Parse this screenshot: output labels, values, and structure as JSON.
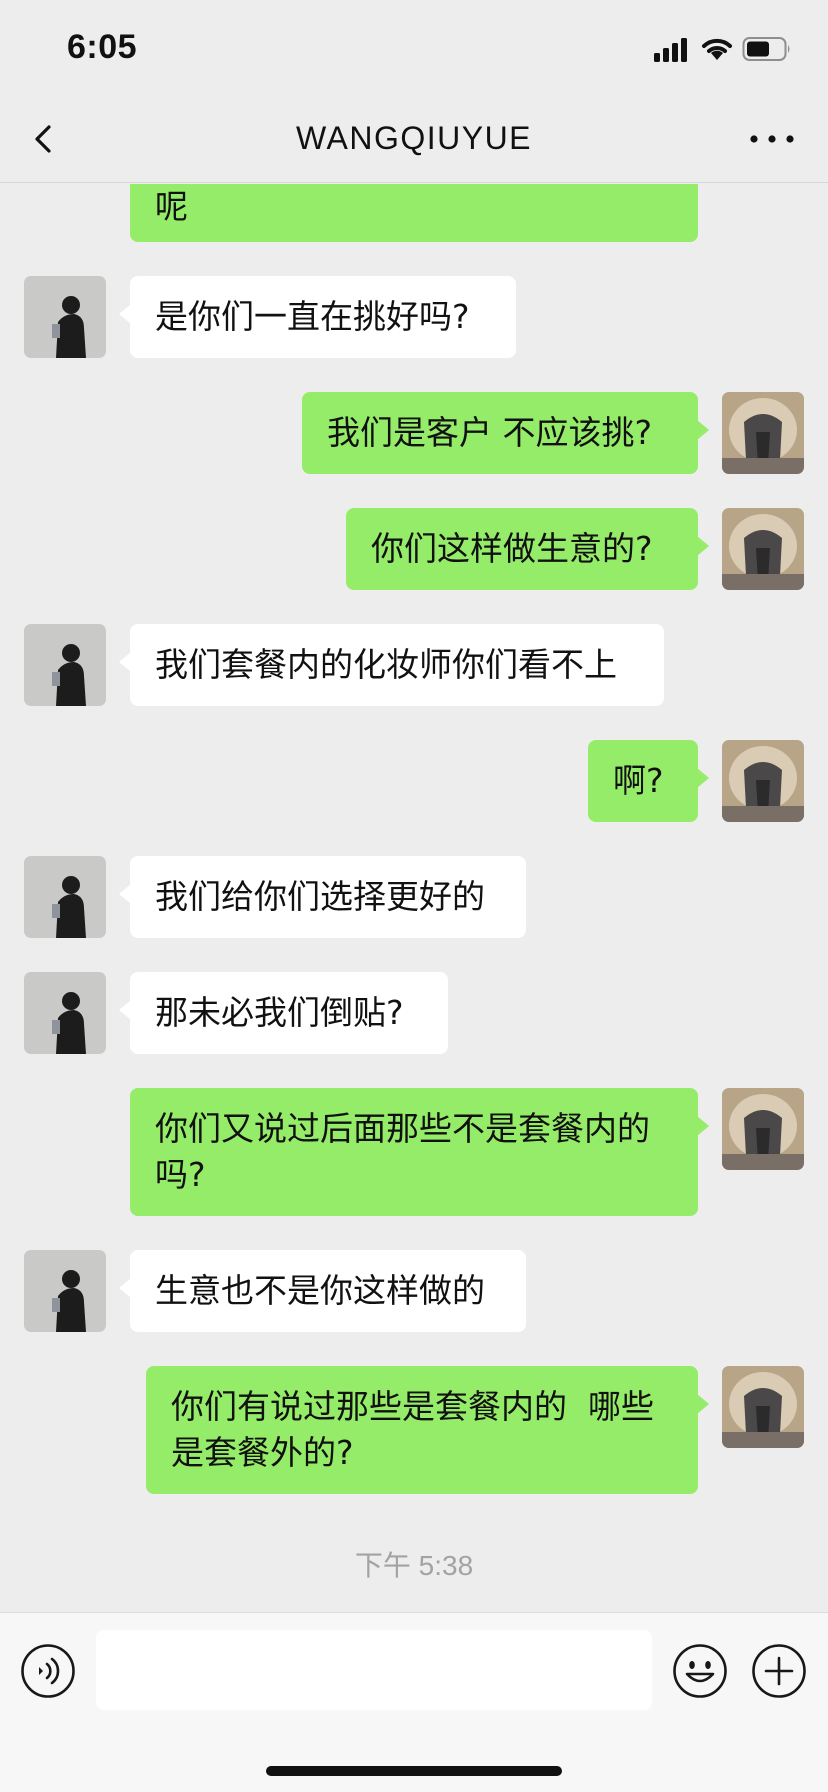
{
  "status_bar": {
    "time": "6:05"
  },
  "nav": {
    "title": "WANGQIUYUE",
    "back_icon": "chevron-left-icon",
    "more_icon": "more-horizontal-icon"
  },
  "messages": [
    {
      "side": "out",
      "text": "呢"
    },
    {
      "side": "in",
      "text": "是你们一直在挑好吗?"
    },
    {
      "side": "out",
      "text": "我们是客户 不应该挑?"
    },
    {
      "side": "out",
      "text": "你们这样做生意的?"
    },
    {
      "side": "in",
      "text": "我们套餐内的化妆师你们看不上"
    },
    {
      "side": "out",
      "text": "啊?"
    },
    {
      "side": "in",
      "text": "我们给你们选择更好的"
    },
    {
      "side": "in",
      "text": "那未必我们倒贴?"
    },
    {
      "side": "out",
      "text": "你们又说过后面那些不是套餐内的",
      "text_line2": "吗?"
    },
    {
      "side": "in",
      "text": "生意也不是你这样做的"
    },
    {
      "side": "out",
      "text": "你们有说过那些是套餐内的  哪些",
      "text_line2": "是套餐外的?"
    }
  ],
  "timestamp": "下午 5:38",
  "input_bar": {
    "placeholder": "",
    "voice_icon": "voice-icon",
    "emoji_icon": "emoji-icon",
    "plus_icon": "plus-circle-icon"
  },
  "colors": {
    "outgoing_bubble": "#95ec69",
    "incoming_bubble": "#ffffff",
    "background": "#ededed"
  }
}
